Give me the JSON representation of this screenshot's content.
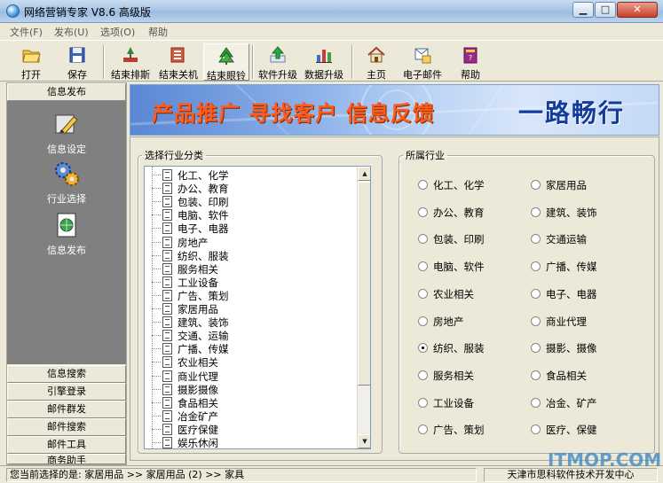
{
  "window": {
    "title": "网络营销专家 V8.6 高级版",
    "min_label": "▁",
    "max_label": "□",
    "close_label": "✕"
  },
  "menu": [
    "文件(F)",
    "发布(U)",
    "选项(O)",
    "帮助"
  ],
  "toolbar": [
    {
      "label": "打开",
      "icon": "folder-open-icon"
    },
    {
      "label": "保存",
      "icon": "floppy-disk-icon"
    },
    {
      "label": "结束排斯",
      "icon": "stop-sort-icon"
    },
    {
      "label": "结束关机",
      "icon": "shutdown-icon"
    },
    {
      "label": "结束眼铃",
      "icon": "alarm-tree-icon"
    },
    {
      "label": "软件升级",
      "icon": "upgrade-arrow-icon"
    },
    {
      "label": "数据升级",
      "icon": "bar-chart-icon"
    },
    {
      "label": "主页",
      "icon": "home-icon"
    },
    {
      "label": "电子邮件",
      "icon": "email-icon"
    },
    {
      "label": "帮助",
      "icon": "help-book-icon"
    }
  ],
  "leftnav": {
    "header": "信息发布",
    "tools": [
      {
        "label": "信息设定",
        "icon": "pen-settings-icon"
      },
      {
        "label": "行业选择",
        "icon": "gears-icon"
      },
      {
        "label": "信息发布",
        "icon": "globe-document-icon"
      }
    ],
    "bottom": [
      "信息搜索",
      "引擎登录",
      "邮件群发",
      "邮件搜索",
      "邮件工具",
      "商务助手"
    ]
  },
  "banner": {
    "text": "产品推广  寻找客户  信息反馈",
    "slogan": "一路畅行"
  },
  "industry_group": {
    "legend": "选择行业分类",
    "items": [
      "化工、化学",
      "办公、教育",
      "包装、印刷",
      "电脑、软件",
      "电子、电器",
      "房地产",
      "纺织、服装",
      "服务相关",
      "工业设备",
      "广告、策划",
      "家居用品",
      "建筑、装饰",
      "交通、运输",
      "广播、传媒",
      "农业相关",
      "商业代理",
      "摄影摄像",
      "食品相关",
      "冶金矿产",
      "医疗保健",
      "娱乐休闲"
    ]
  },
  "category_group": {
    "legend": "所属行业",
    "left": [
      "化工、化学",
      "办公、教育",
      "包装、印刷",
      "电脑、软件",
      "农业相关",
      "房地产",
      "纺织、服装",
      "服务相关",
      "工业设备",
      "广告、策划"
    ],
    "right": [
      "家居用品",
      "建筑、装饰",
      "交通运输",
      "广播、传媒",
      "电子、电器",
      "商业代理",
      "摄影、摄像",
      "食品相关",
      "冶金、矿产",
      "医疗、保健"
    ],
    "checked": "纺织、服装"
  },
  "status": {
    "left": "您当前选择的是: 家居用品  >> 家居用品 (2)  >> 家具",
    "right": "天津市思科软件技术开发中心"
  },
  "watermark": "ITMOP.COM"
}
